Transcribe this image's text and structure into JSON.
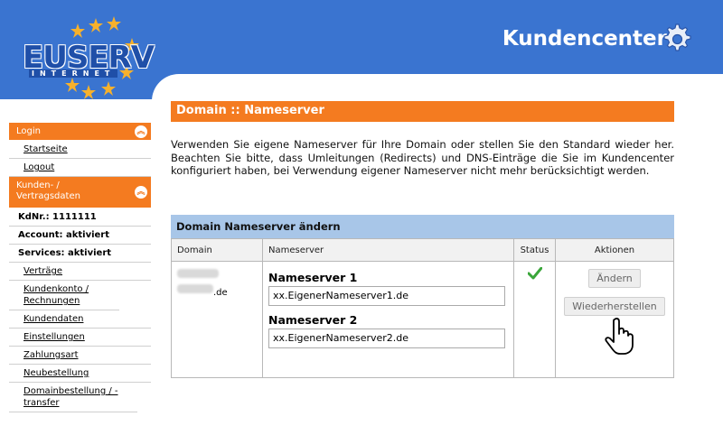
{
  "header": {
    "logo_text": "EUSERV",
    "logo_sub": "INTERNET",
    "title": "Kundencenter"
  },
  "sidebar": {
    "login_header": "Login",
    "links1": [
      "Startseite",
      "Logout"
    ],
    "kunden_header": "Kunden- / Vertragsdaten",
    "info": [
      "KdNr.: 1111111",
      "Account: aktiviert",
      "Services: aktiviert"
    ],
    "links2": [
      "Verträge",
      "Kundenkonto / Rechnungen",
      "Kundendaten",
      "Einstellungen",
      "Zahlungsart",
      "Neubestellung",
      "Domainbestellung / -transfer"
    ]
  },
  "content": {
    "heading": "Domain :: Nameserver",
    "intro": "Verwenden Sie eigene Nameserver für Ihre Domain oder stellen Sie den Standard wieder her. Beachten Sie bitte, dass Umleitungen (Redirects) und DNS-Einträge die Sie im Kundencenter konfiguriert haben, bei Verwendung eigener Nameserver nicht mehr berücksichtigt werden."
  },
  "panel": {
    "title": "Domain Nameserver ändern",
    "columns": [
      "Domain",
      "Nameserver",
      "Status",
      "Aktionen"
    ],
    "domain_suffix": ".de",
    "ns1_label": "Nameserver 1",
    "ns1_value": "xx.EigenerNameserver1.de",
    "ns2_label": "Nameserver 2",
    "ns2_value": "xx.EigenerNameserver2.de",
    "status_icon": "checkmark-icon",
    "btn_change": "Ändern",
    "btn_restore": "Wiederherstellen"
  },
  "colors": {
    "header_blue": "#3a74d0",
    "accent_orange": "#f47b20",
    "panel_blue": "#a8c6e8",
    "status_green": "#3aa63a"
  }
}
